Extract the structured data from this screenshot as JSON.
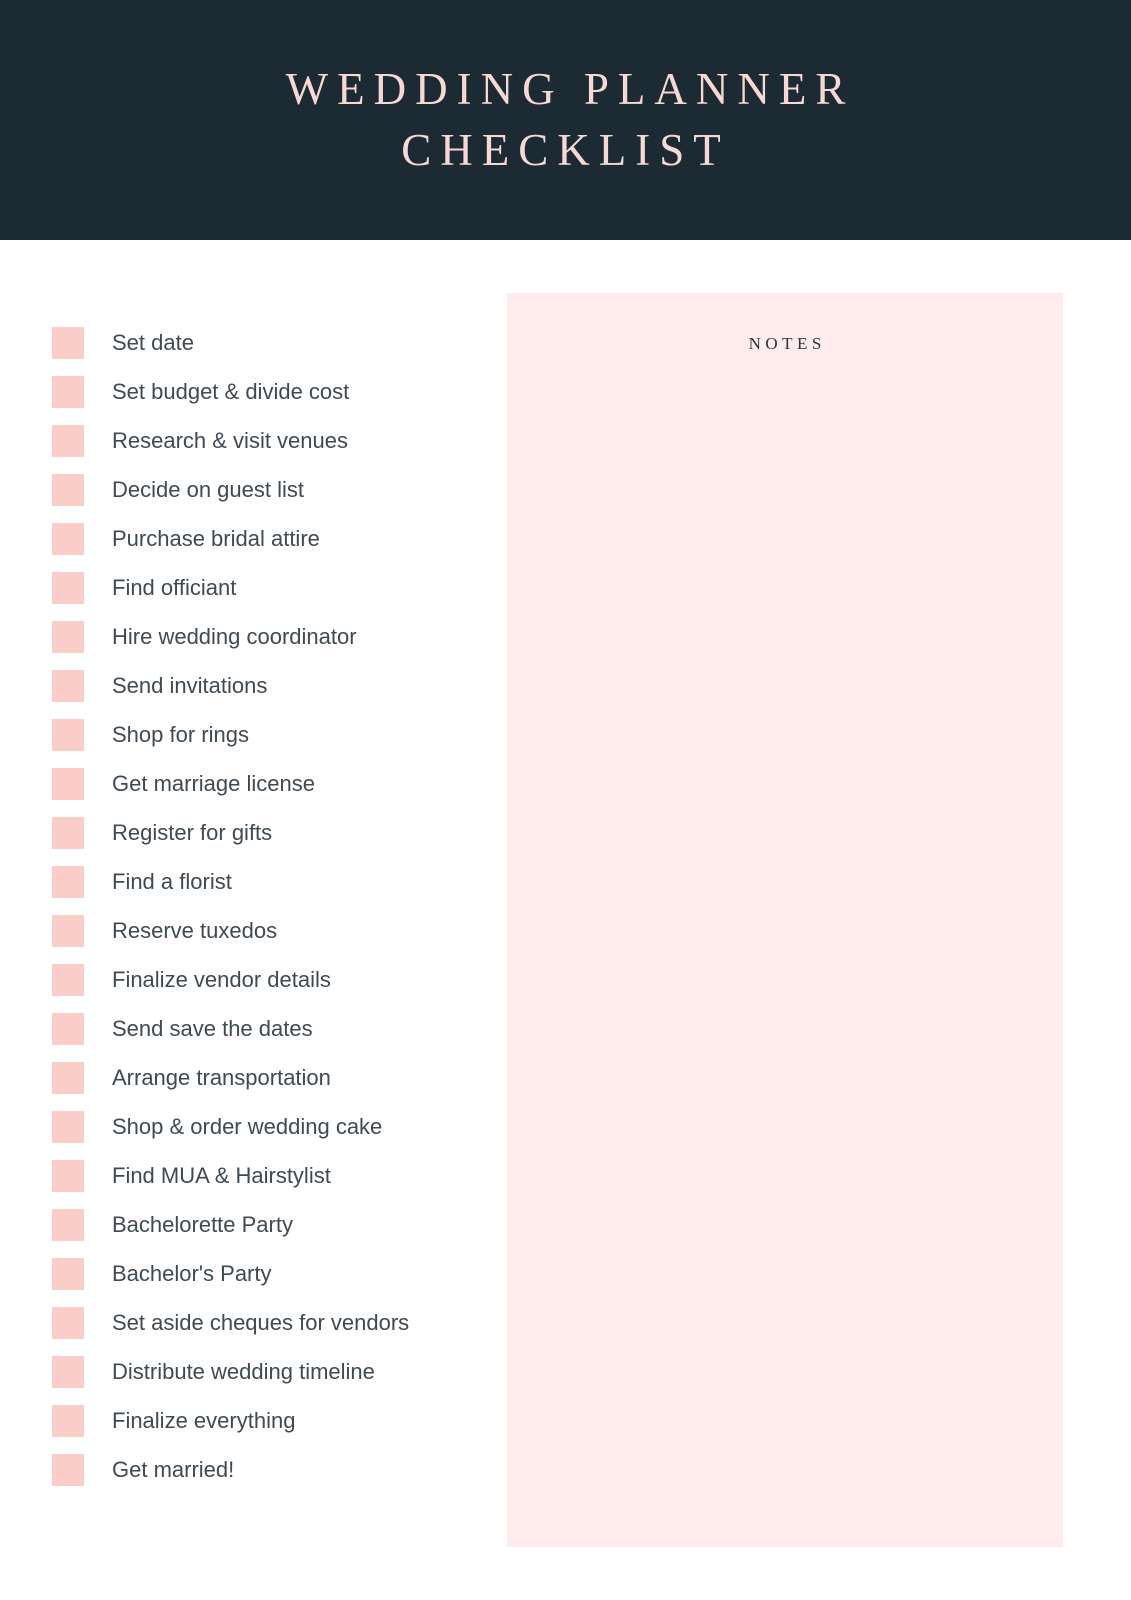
{
  "header": {
    "title": "WEDDING PLANNER\nCHECKLIST",
    "background_color": "#1c2a33",
    "title_color": "#f7d8d2"
  },
  "checklist": {
    "checkbox_color": "#fbcdc8",
    "text_color": "#3f4a52",
    "items": [
      {
        "label": "Set date",
        "checked": false
      },
      {
        "label": "Set budget & divide cost",
        "checked": false
      },
      {
        "label": "Research & visit venues",
        "checked": false
      },
      {
        "label": "Decide on guest list",
        "checked": false
      },
      {
        "label": "Purchase bridal attire",
        "checked": false
      },
      {
        "label": "Find officiant",
        "checked": false
      },
      {
        "label": "Hire wedding coordinator",
        "checked": false
      },
      {
        "label": "Send invitations",
        "checked": false
      },
      {
        "label": "Shop for rings",
        "checked": false
      },
      {
        "label": "Get marriage license",
        "checked": false
      },
      {
        "label": "Register for gifts",
        "checked": false
      },
      {
        "label": "Find a florist",
        "checked": false
      },
      {
        "label": "Reserve tuxedos",
        "checked": false
      },
      {
        "label": "Finalize vendor details",
        "checked": false
      },
      {
        "label": "Send save the dates",
        "checked": false
      },
      {
        "label": "Arrange transportation",
        "checked": false
      },
      {
        "label": "Shop & order wedding cake",
        "checked": false
      },
      {
        "label": "Find MUA & Hairstylist",
        "checked": false
      },
      {
        "label": "Bachelorette Party",
        "checked": false
      },
      {
        "label": "Bachelor's Party",
        "checked": false
      },
      {
        "label": "Set aside cheques for vendors",
        "checked": false
      },
      {
        "label": "Distribute wedding timeline",
        "checked": false
      },
      {
        "label": "Finalize everything",
        "checked": false
      },
      {
        "label": "Get married!",
        "checked": false
      }
    ]
  },
  "notes": {
    "title": "NOTES",
    "content": "",
    "background_color": "#fdeceb",
    "title_color": "#2d3338"
  }
}
